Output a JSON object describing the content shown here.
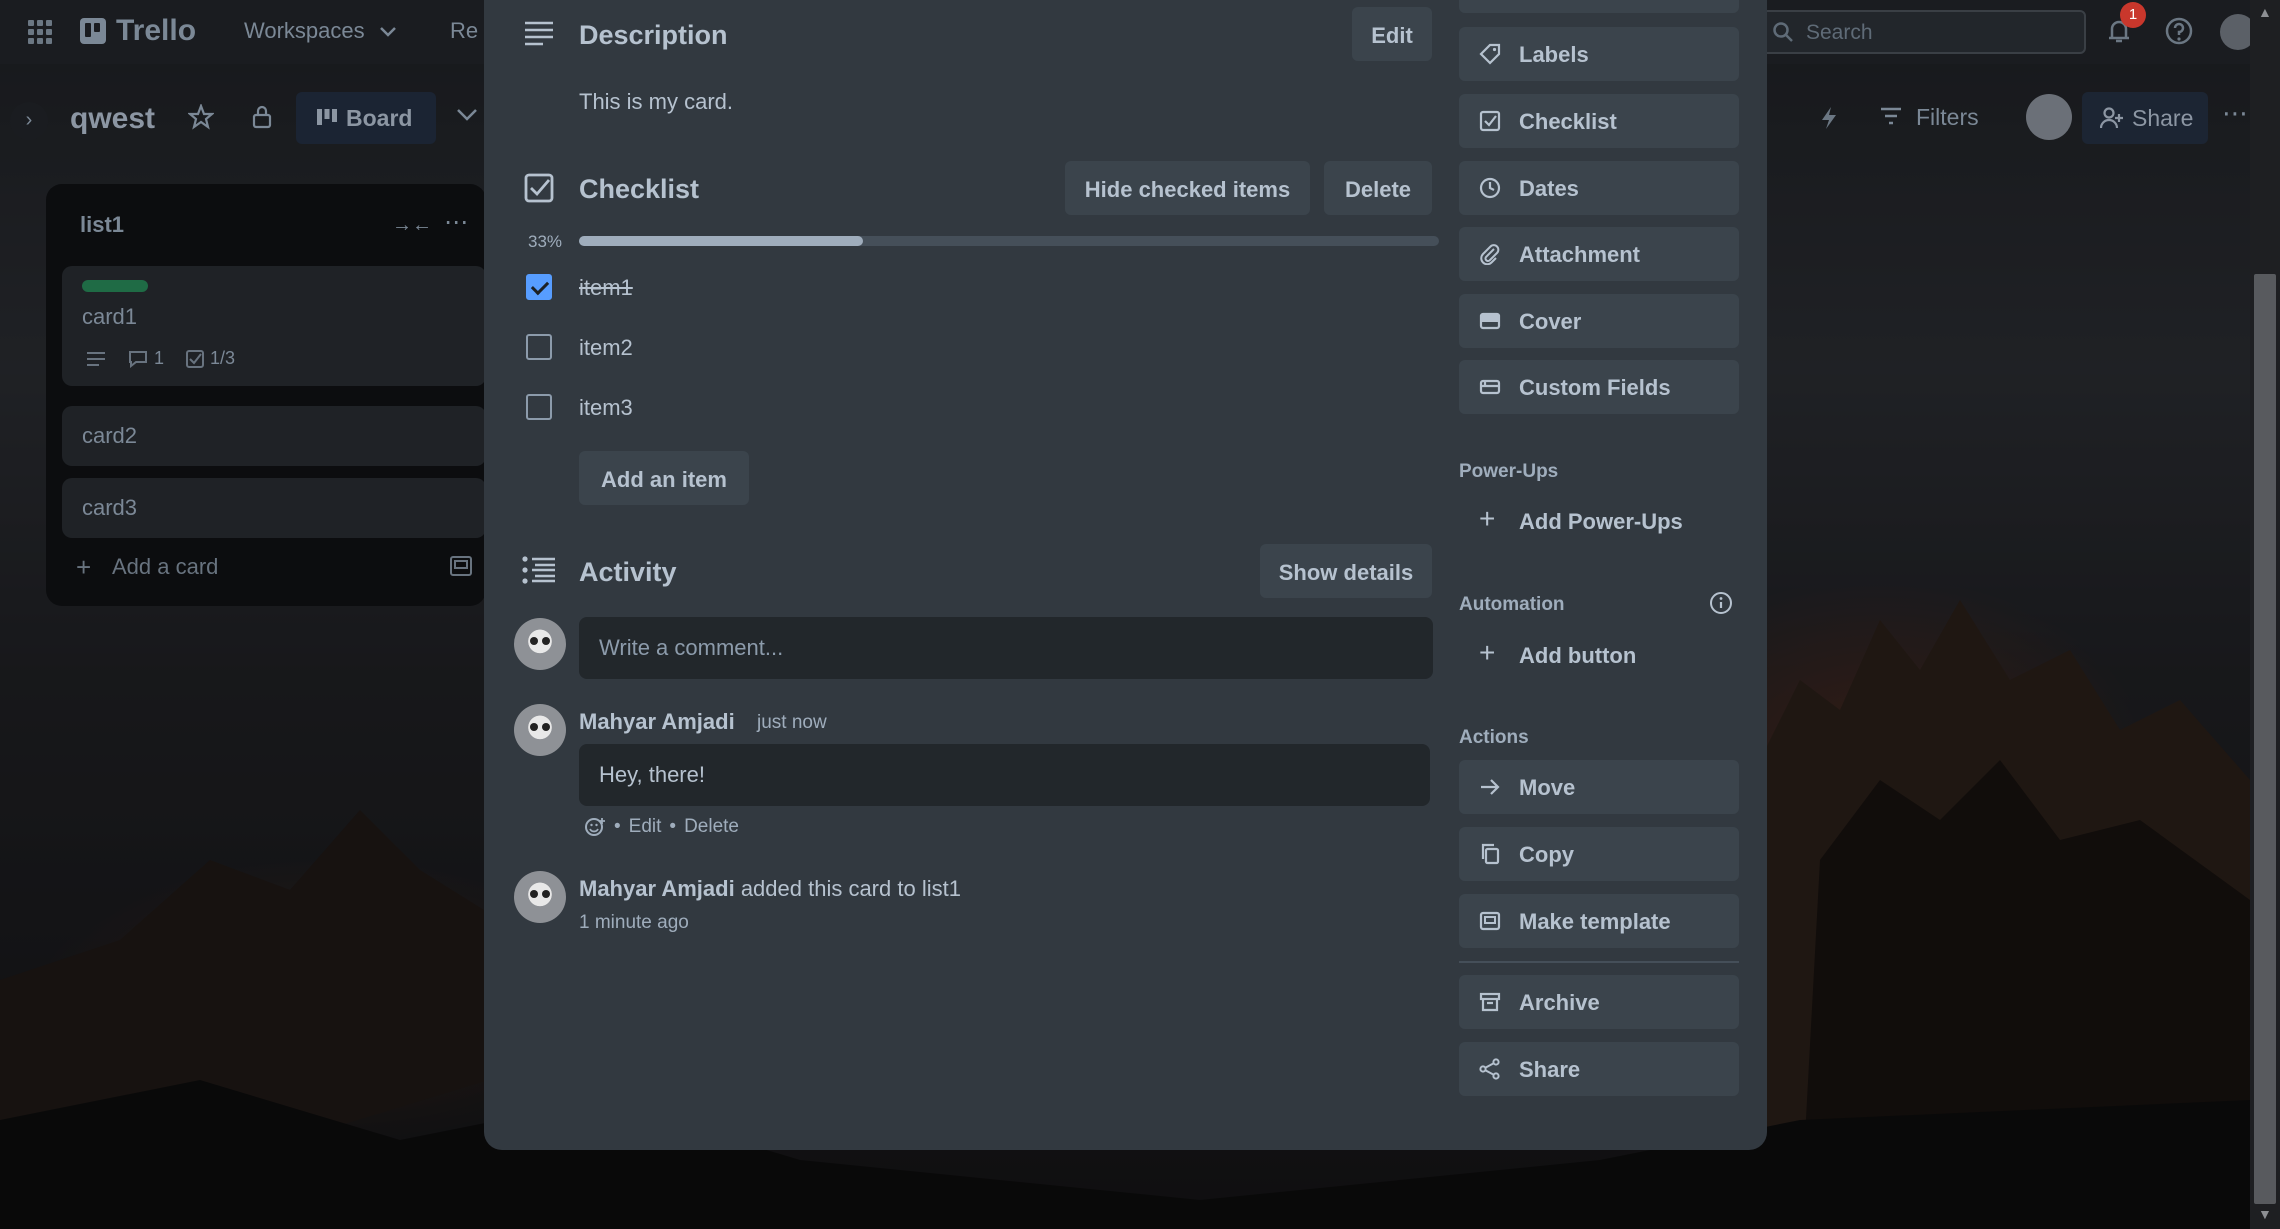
{
  "app": {
    "logo": "Trello",
    "workspaces_label": "Workspaces",
    "recent_label": "Re",
    "search_placeholder": "Search",
    "notification_count": "1"
  },
  "board": {
    "title": "qwest",
    "view_label": "Board",
    "filters_label": "Filters",
    "share_label": "Share"
  },
  "list": {
    "title": "list1",
    "cards": [
      {
        "title": "card1",
        "label_color": "#1f6b45",
        "comments": "1",
        "checklist": "1/3"
      },
      {
        "title": "card2"
      },
      {
        "title": "card3"
      }
    ],
    "add_card_label": "Add a card"
  },
  "modal": {
    "description": {
      "title": "Description",
      "edit_label": "Edit",
      "text": "This is my card."
    },
    "checklist": {
      "title": "Checklist",
      "hide_checked_label": "Hide checked items",
      "delete_label": "Delete",
      "progress_text": "33%",
      "progress_fraction": 0.33,
      "items": [
        {
          "text": "item1",
          "checked": true
        },
        {
          "text": "item2",
          "checked": false
        },
        {
          "text": "item3",
          "checked": false
        }
      ],
      "add_item_label": "Add an item"
    },
    "activity": {
      "title": "Activity",
      "show_details_label": "Show details",
      "comment_placeholder": "Write a comment...",
      "comment": {
        "author": "Mahyar Amjadi",
        "time": "just now",
        "text": "Hey, there!",
        "edit_label": "Edit",
        "delete_label": "Delete",
        "separator": "•"
      },
      "event": {
        "author": "Mahyar Amjadi",
        "action": "added this card to list1",
        "time": "1 minute ago"
      }
    },
    "sidebar": {
      "add_to_card": [
        {
          "label": "Labels",
          "icon": "tag-icon"
        },
        {
          "label": "Checklist",
          "icon": "checklist-icon"
        },
        {
          "label": "Dates",
          "icon": "clock-icon"
        },
        {
          "label": "Attachment",
          "icon": "paperclip-icon"
        },
        {
          "label": "Cover",
          "icon": "cover-icon"
        },
        {
          "label": "Custom Fields",
          "icon": "custom-fields-icon"
        }
      ],
      "power_ups_heading": "Power-Ups",
      "add_power_ups_label": "Add Power-Ups",
      "automation_heading": "Automation",
      "add_button_label": "Add button",
      "actions_heading": "Actions",
      "actions": [
        {
          "label": "Move",
          "icon": "arrow-right-icon"
        },
        {
          "label": "Copy",
          "icon": "copy-icon"
        },
        {
          "label": "Make template",
          "icon": "template-icon"
        },
        {
          "label": "Archive",
          "icon": "archive-icon"
        },
        {
          "label": "Share",
          "icon": "share-icon"
        }
      ]
    }
  },
  "colors": {
    "modal_bg": "#323940",
    "button_bg": "#3b444c",
    "checkbox_checked": "#579dff",
    "text": "#b6c2cf"
  }
}
